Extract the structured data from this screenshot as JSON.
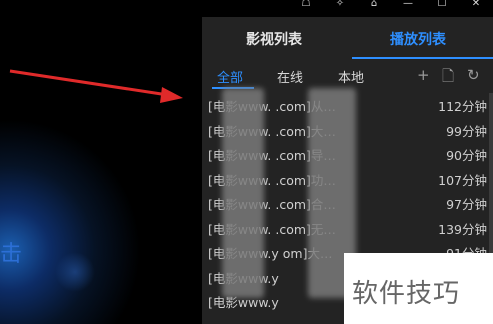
{
  "window": {
    "controls": [
      {
        "icon": "skin-icon"
      },
      {
        "icon": "pin-icon"
      },
      {
        "icon": "feedback-icon"
      },
      {
        "icon": "minimize-icon"
      },
      {
        "icon": "maximize-icon"
      },
      {
        "icon": "close-icon"
      }
    ]
  },
  "video": {
    "visible_text": "击"
  },
  "panel": {
    "main_tabs": [
      "影视列表",
      "播放列表"
    ],
    "active_main_tab": "播放列表",
    "sub_tabs": [
      "全部",
      "在线",
      "本地"
    ],
    "active_sub_tab": "全部",
    "sub_icons": [
      "add-icon",
      "file-delete-icon",
      "refresh-icon"
    ],
    "items": [
      {
        "title": "[电影www.     .com]从…",
        "duration": "112分钟"
      },
      {
        "title": "[电影www.     .com]大…",
        "duration": "99分钟"
      },
      {
        "title": "[电影www.     .com]导…",
        "duration": "90分钟"
      },
      {
        "title": "[电影www.     .com]功…",
        "duration": "107分钟"
      },
      {
        "title": "[电影www.     .com]合…",
        "duration": "97分钟"
      },
      {
        "title": "[电影www.     .com]无…",
        "duration": "139分钟"
      },
      {
        "title": "[电影www.y     om]大…",
        "duration": "91分钟"
      },
      {
        "title": "[电影www.y",
        "duration": ""
      },
      {
        "title": "[电影www.y",
        "duration": ""
      }
    ]
  },
  "watermark": {
    "text": "软件技巧"
  },
  "colors": {
    "accent": "#2e8fff",
    "panel_bg": "#232323"
  }
}
